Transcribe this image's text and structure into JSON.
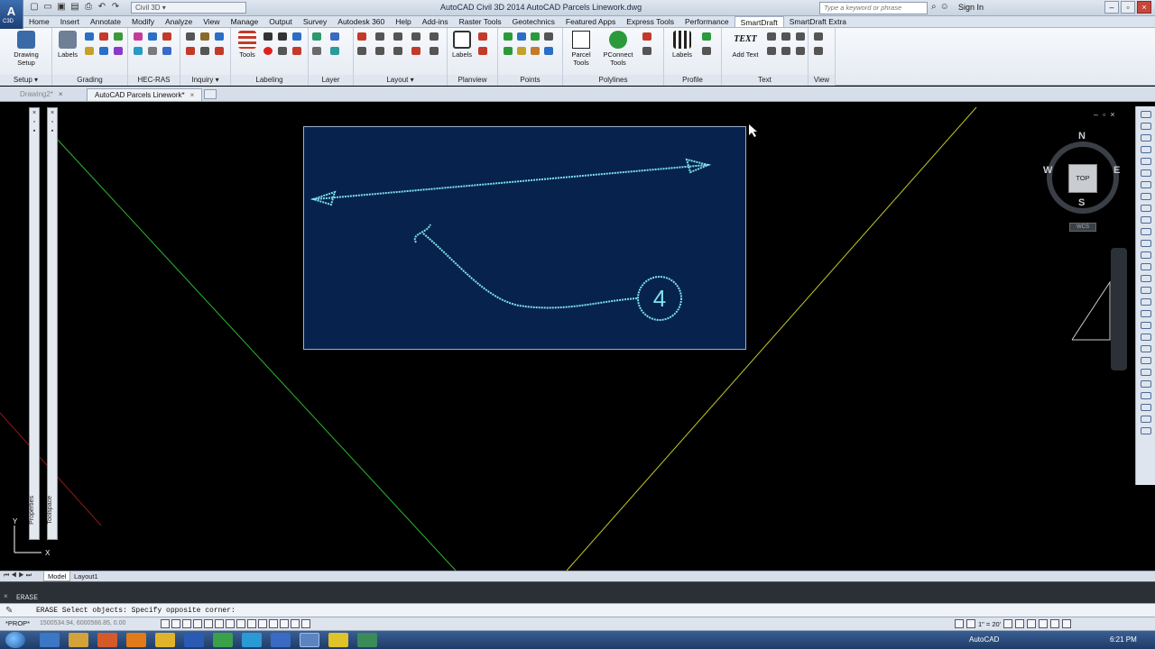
{
  "titlebar": {
    "app_letter": "A",
    "app_sub": "C3D",
    "workspace": "Civil 3D",
    "window_title": "AutoCAD Civil 3D 2014    AutoCAD Parcels Linework.dwg",
    "search_placeholder": "Type a keyword or phrase",
    "sign_in": "Sign In",
    "controls": {
      "minimize": "–",
      "restore": "▫",
      "close": "×"
    }
  },
  "ribbon_tabs": [
    "Home",
    "Insert",
    "Annotate",
    "Modify",
    "Analyze",
    "View",
    "Manage",
    "Output",
    "Survey",
    "Autodesk 360",
    "Help",
    "Add-ins",
    "Raster Tools",
    "Geotechnics",
    "Featured Apps",
    "Express Tools",
    "Performance",
    "SmartDraft",
    "SmartDraft Extra"
  ],
  "active_tab": "SmartDraft",
  "panels": [
    {
      "title": "Setup ▾",
      "buttons": [
        "Drawing\nSetup"
      ]
    },
    {
      "title": "Grading",
      "buttons": [
        "Labels"
      ]
    },
    {
      "title": "HEC-RAS",
      "buttons": []
    },
    {
      "title": "Inquiry ▾",
      "buttons": []
    },
    {
      "title": "Labeling",
      "buttons": [
        "Tools"
      ]
    },
    {
      "title": "Layer",
      "buttons": []
    },
    {
      "title": "Layout ▾",
      "buttons": []
    },
    {
      "title": "Planview",
      "buttons": [
        "Labels"
      ]
    },
    {
      "title": "Points",
      "buttons": []
    },
    {
      "title": "Polylines",
      "buttons": [
        "Parcel\nTools",
        "PConnect\nTools"
      ]
    },
    {
      "title": "Profile",
      "buttons": [
        "Labels"
      ]
    },
    {
      "title": "Text",
      "buttons": [
        "Add Text"
      ]
    },
    {
      "title": "View",
      "buttons": []
    }
  ],
  "add_text_icon": "TEXT",
  "doc_tabs": [
    {
      "label": "Drawing2*",
      "active": false
    },
    {
      "label": "AutoCAD Parcels Linework*",
      "active": true
    }
  ],
  "palettes": {
    "properties": "Properties",
    "toolspace": "Toolspace"
  },
  "inset": {
    "number": "4"
  },
  "viewcube": {
    "n": "N",
    "s": "S",
    "e": "E",
    "w": "W",
    "top": "TOP",
    "wcs": "WCS"
  },
  "model_tabs": {
    "model": "Model",
    "layout": "Layout1"
  },
  "command": {
    "history": "ERASE",
    "prompt": "ERASE Select objects: Specify opposite corner:"
  },
  "status": {
    "prop": "*PROP*",
    "coords": "1500534.94, 6000566.85, 0.00",
    "scale": "1\" = 20'",
    "workspace": "AutoCAD"
  },
  "taskbar": {
    "time": "6:21 PM"
  },
  "colors": {
    "green_line": "#2db52d",
    "yellow_line": "#c8c826",
    "red_line": "#8c1a1a",
    "inset_bg": "#06224d",
    "sketch": "#7fe3f0"
  }
}
